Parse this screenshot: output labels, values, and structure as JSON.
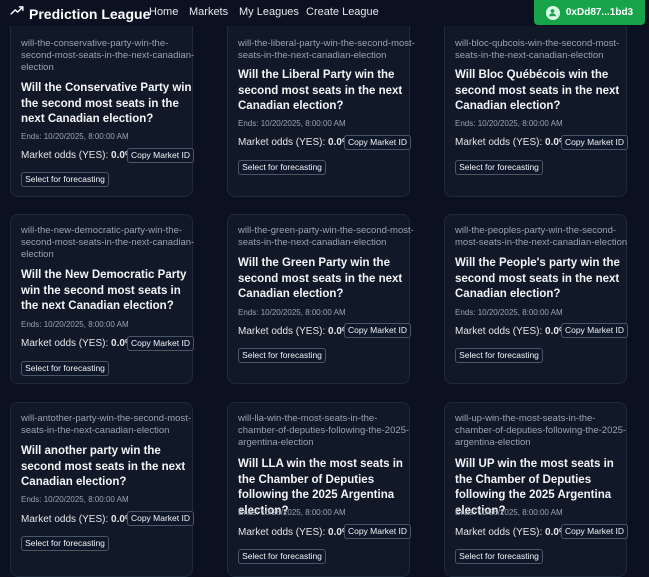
{
  "nav": {
    "brand": "Prediction League",
    "links": [
      "Home",
      "Markets",
      "My Leagues",
      "Create League"
    ],
    "wallet": "0xDd87...1bd3"
  },
  "labels": {
    "ends_prefix": "Ends:",
    "odds_label": "Market odds (YES):",
    "copy": "Copy Market ID",
    "select": "Select for forecasting"
  },
  "markets": [
    {
      "slug": "will-the-conservative-party-win-the-second-most-seats-in-the-next-canadian-election",
      "question": "Will the Conservative Party win the second most seats in the next Canadian election?",
      "ends": "10/20/2025, 8:00:00 AM",
      "odds": "0.0%"
    },
    {
      "slug": "will-the-liberal-party-win-the-second-most-seats-in-the-next-canadian-election",
      "question": "Will the Liberal Party win the second most seats in the next Canadian election?",
      "ends": "10/20/2025, 8:00:00 AM",
      "odds": "0.0%"
    },
    {
      "slug": "will-bloc-qubcois-win-the-second-most-seats-in-the-next-canadian-election",
      "question": "Will Bloc Québécois win the second most seats in the next Canadian election?",
      "ends": "10/20/2025, 8:00:00 AM",
      "odds": "0.0%"
    },
    {
      "slug": "will-the-new-democratic-party-win-the-second-most-seats-in-the-next-canadian-election",
      "question": "Will the New Democratic Party win the second most seats in the next Canadian election?",
      "ends": "10/20/2025, 8:00:00 AM",
      "odds": "0.0%"
    },
    {
      "slug": "will-the-green-party-win-the-second-most-seats-in-the-next-canadian-election",
      "question": "Will the Green Party win the second most seats in the next Canadian election?",
      "ends": "10/20/2025, 8:00:00 AM",
      "odds": "0.0%"
    },
    {
      "slug": "will-the-peoples-party-win-the-second-most-seats-in-the-next-canadian-election",
      "question": "Will the People's party win the second most seats in the next Canadian election?",
      "ends": "10/20/2025, 8:00:00 AM",
      "odds": "0.0%"
    },
    {
      "slug": "will-antother-party-win-the-second-most-seats-in-the-next-canadian-election",
      "question": "Will another party win the second most seats in the next Canadian election?",
      "ends": "10/20/2025, 8:00:00 AM",
      "odds": "0.0%"
    },
    {
      "slug": "will-lla-win-the-most-seats-in-the-chamber-of-deputies-following-the-2025-argentina-election",
      "question": "Will LLA win the most seats in the Chamber of Deputies following the 2025 Argentina election?",
      "ends": "10/26/2025, 8:00:00 AM",
      "odds": "0.0%"
    },
    {
      "slug": "will-up-win-the-most-seats-in-the-chamber-of-deputies-following-the-2025-argentina-election",
      "question": "Will UP win the most seats in the Chamber of Deputies following the 2025 Argentina election?",
      "ends": "10/26/2025, 8:00:00 AM",
      "odds": "0.0%"
    }
  ]
}
